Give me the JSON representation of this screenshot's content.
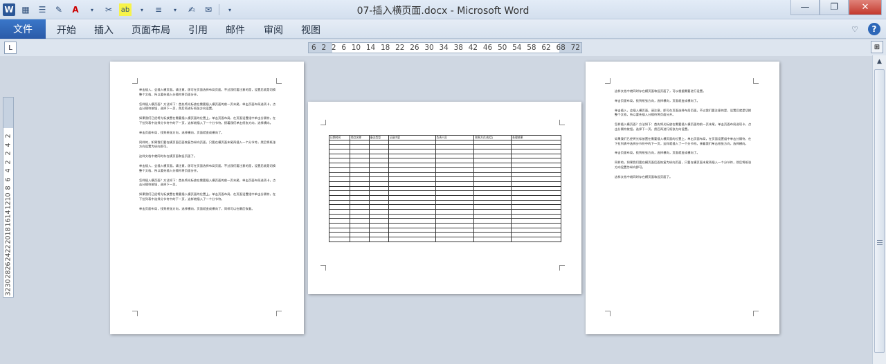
{
  "window": {
    "title": "07-插入横页面.docx - Microsoft Word"
  },
  "qat": {
    "app_icon": "W"
  },
  "ribbon": {
    "file": "文件",
    "tabs": [
      "开始",
      "插入",
      "页面布局",
      "引用",
      "邮件",
      "审阅",
      "视图"
    ]
  },
  "ruler": {
    "h_numbers": [
      "6",
      "2",
      "2",
      "6",
      "10",
      "14",
      "18",
      "22",
      "26",
      "30",
      "34",
      "38",
      "42",
      "46",
      "50",
      "54",
      "58",
      "62",
      "68",
      "72"
    ],
    "v_numbers": [
      "2",
      "4",
      "2",
      "2",
      "4",
      "6",
      "8",
      "10",
      "12",
      "14",
      "16",
      "18",
      "20",
      "22",
      "24",
      "26",
      "28",
      "30",
      "32"
    ],
    "tab_selector": "L"
  },
  "pages": {
    "left": {
      "paragraphs": [
        "单击插入，会插入横页面。请注意，即可在页面选择布局页面。不过我们要注意的是，设置后就是切换整个文档，所以要先插入分隔符将页面分开。",
        "怎样插入横页面？方法如下：首先将光标放在需要插入横页面的前一页末尾，单击页面布局选项卡，点击分隔符按钮，选择下一页，然后再进行纸张方向设置。",
        "如果我们已经将光标放置在需要插入横页面的位置上，单击页面布局，在页面设置组中单击分隔符，在下拉列表中选择分节符中的下一页，这样就插入了一个分节符。接着我们单击纸张方向，选择横向。",
        "单击页面布局，找到纸张方向，选择横向，页面就变成横向了。",
        "同样的，如果我们要在横页面后面恢复为纵向页面，只要在横页面末尾再插入一个分节符，然后将纸张方向设置为纵向即可。",
        "这样文档中就同时存在横页面和竖页面了。",
        "单击插入，会插入横页面。请注意，即可在页面选择布局页面。不过我们要注意的是，设置后就是切换整个文档，所以要先插入分隔符将页面分开。",
        "怎样插入横页面？方法如下：首先将光标放在需要插入横页面的前一页末尾，单击页面布局选项卡，点击分隔符按钮，选择下一页。",
        "如果我们已经将光标放置在需要插入横页面的位置上，单击页面布局，在页面设置组中单击分隔符，在下拉列表中选择分节符中的下一页，这样就插入了一个分节符。",
        "单击页面布局，找到纸张方向，选择横向，页面就变成横向了，同样可以在最后恢复。"
      ]
    },
    "middle": {
      "table_headers": [
        "日期时间",
        "地点名称",
        "备注类型",
        "记录内容",
        "负责人员",
        "联系方式(电话)",
        "处理结果"
      ],
      "table_rows": 22
    },
    "right": {
      "paragraphs": [
        "这样文档中就同时存在横页面和竖页面了，可以根据需要进行设置。",
        "单击页面布局，找到纸张方向，选择横向，页面就变成横向了。",
        "单击插入，会插入横页面。请注意，即可在页面选择布局页面。不过我们要注意的是，设置后就是切换整个文档，所以要先插入分隔符将页面分开。",
        "怎样插入横页面？方法如下：首先将光标放在需要插入横页面的前一页末尾，单击页面布局选项卡，点击分隔符按钮，选择下一页，然后再进行纸张方向设置。",
        "如果我们已经将光标放置在需要插入横页面的位置上，单击页面布局，在页面设置组中单击分隔符，在下拉列表中选择分节符中的下一页，这样就插入了一个分节符。接着我们单击纸张方向，选择横向。",
        "单击页面布局，找到纸张方向，选择横向，页面就变成横向了。",
        "同样的，如果我们要在横页面后面恢复为纵向页面，只要在横页面末尾再插入一个分节符，然后将纸张方向设置为纵向即可。",
        "这样文档中就同时存在横页面和竖页面了。"
      ]
    }
  }
}
